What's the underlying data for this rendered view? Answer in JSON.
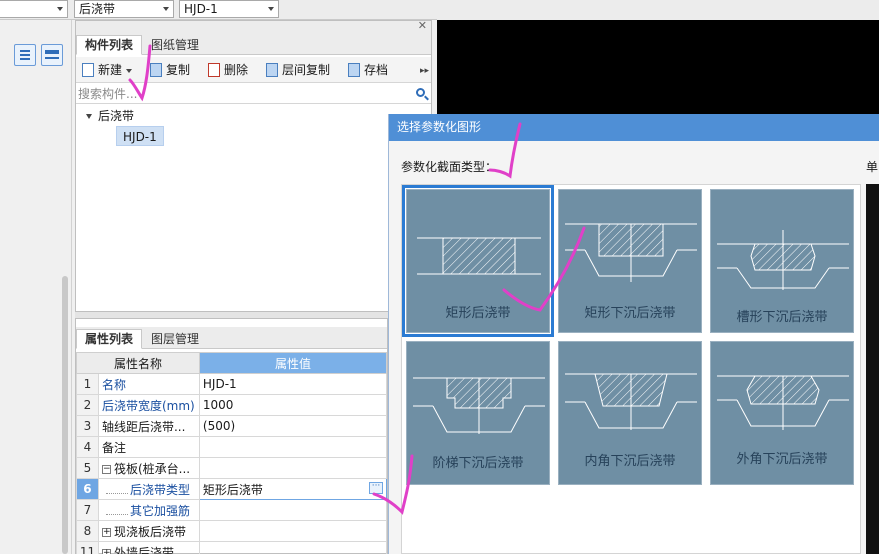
{
  "top_bar": {
    "combo_2": "后浇带",
    "combo_3": "HJD-1"
  },
  "component_panel": {
    "tabs": [
      {
        "label": "构件列表",
        "active": true
      },
      {
        "label": "图纸管理",
        "active": false
      }
    ],
    "toolbar": {
      "new_label": "新建",
      "copy_label": "复制",
      "delete_label": "删除",
      "floor_copy_label": "层间复制",
      "save_label": "存档"
    },
    "search_placeholder": "搜索构件...",
    "tree": {
      "root": "后浇带",
      "child": "HJD-1"
    }
  },
  "property_panel": {
    "tabs": [
      {
        "label": "属性列表",
        "active": true
      },
      {
        "label": "图层管理",
        "active": false
      }
    ],
    "col_name": "属性名称",
    "col_value": "属性值",
    "rows": [
      {
        "num": "1",
        "name": "名称",
        "value": "HJD-1"
      },
      {
        "num": "2",
        "name": "后浇带宽度(mm)",
        "value": "1000"
      },
      {
        "num": "3",
        "name": "轴线距后浇带...",
        "value": "(500)"
      },
      {
        "num": "4",
        "name": "备注",
        "value": ""
      },
      {
        "num": "5",
        "name": "筏板(桩承台...",
        "value": ""
      },
      {
        "num": "6",
        "name": "后浇带类型",
        "value": "矩形后浇带"
      },
      {
        "num": "7",
        "name": "其它加强筋",
        "value": ""
      },
      {
        "num": "8",
        "name": "现浇板后浇带",
        "value": ""
      },
      {
        "num": "11",
        "name": "外墙后浇带",
        "value": ""
      }
    ]
  },
  "dialog": {
    "title": "选择参数化图形",
    "section_label": "参数化截面类型：",
    "unit_label": "单",
    "shapes": [
      {
        "label": "矩形后浇带",
        "selected": true
      },
      {
        "label": "矩形下沉后浇带",
        "selected": false
      },
      {
        "label": "槽形下沉后浇带",
        "selected": false
      },
      {
        "label": "阶梯下沉后浇带",
        "selected": false
      },
      {
        "label": "内角下沉后浇带",
        "selected": false
      },
      {
        "label": "外角下沉后浇带",
        "selected": false
      }
    ]
  },
  "colors": {
    "tile_bg": "#6f8fa4",
    "selection": "#2b7bd3",
    "dialog_header": "#4f8fd6",
    "annotation": "#e040c8"
  },
  "icons": [
    "search-icon",
    "list-view-icon",
    "detail-view-icon",
    "new-icon",
    "copy-icon",
    "delete-icon",
    "floor-copy-icon",
    "save-icon",
    "close-icon",
    "ellipsis-icon"
  ]
}
